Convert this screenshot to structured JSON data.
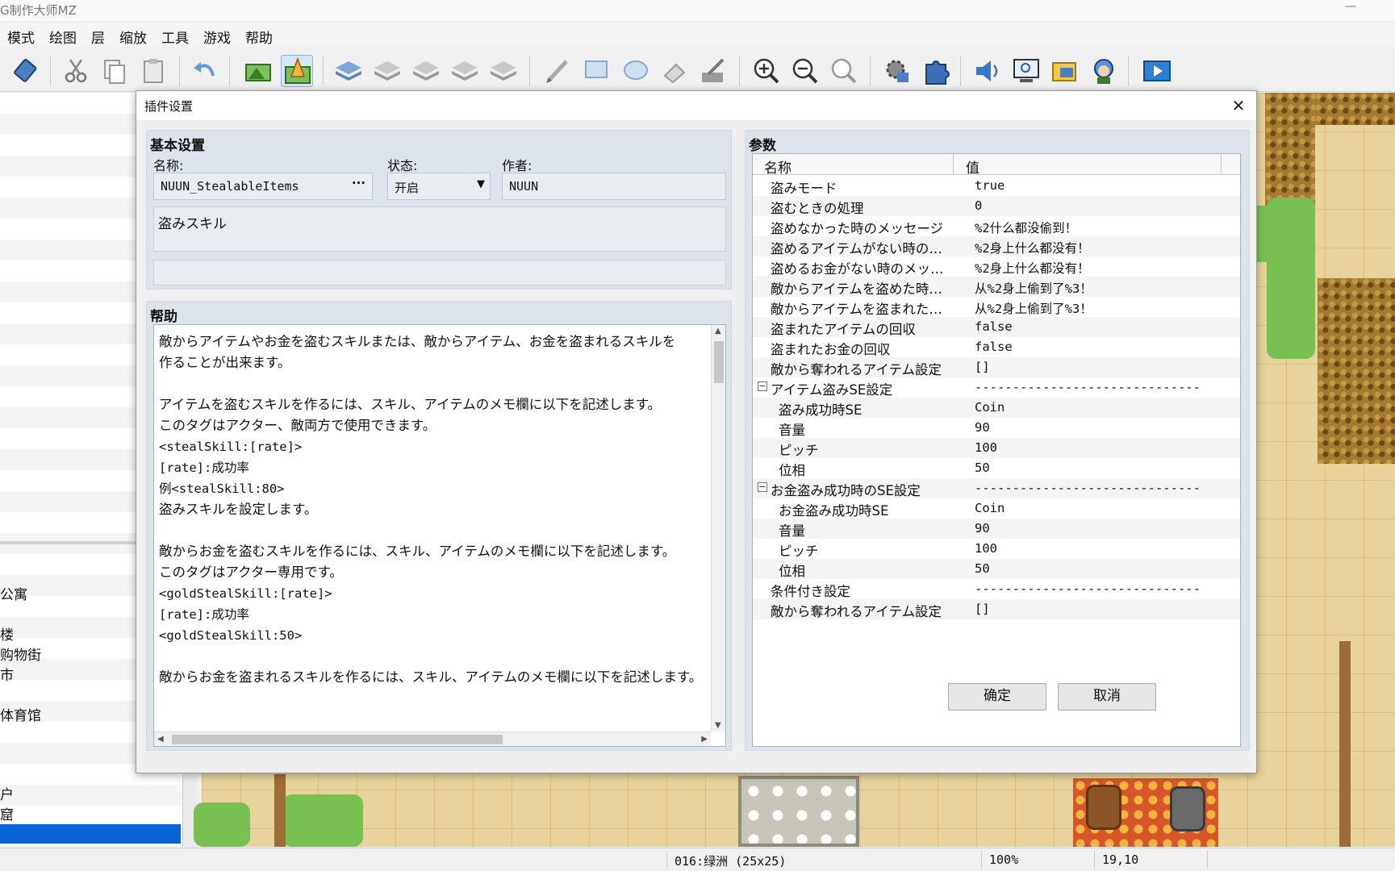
{
  "window": {
    "title": "G制作大师MZ",
    "minimize": "—"
  },
  "menu": [
    "模式",
    "绘图",
    "层",
    "缩放",
    "工具",
    "游戏",
    "帮助"
  ],
  "toolbar_icons": [
    "database-icon",
    "cut-icon",
    "copy-icon",
    "paste-icon",
    "undo-icon",
    "map-mode-icon",
    "event-mode-icon",
    "layer-a-icon",
    "layer-b-icon",
    "layer-c-icon",
    "layer-d-icon",
    "layer-e-icon",
    "pencil-icon",
    "rectangle-icon",
    "ellipse-icon",
    "fill-icon",
    "shadow-pen-icon",
    "zoom-in-icon",
    "zoom-out-icon",
    "zoom-actual-icon",
    "database-settings-icon",
    "plugin-manager-icon",
    "sound-test-icon",
    "event-searcher-icon",
    "resource-manager-icon",
    "character-generator-icon",
    "playtest-icon"
  ],
  "left_items": [
    "公寓",
    "楼",
    "购物街",
    "市",
    "体育馆",
    "户",
    "窟"
  ],
  "status": {
    "map": "016:绿洲 (25x25)",
    "zoom": "100%",
    "coords": "19,10"
  },
  "dialog": {
    "title": "插件设置",
    "basic": {
      "title": "基本设置",
      "name_label": "名称:",
      "name_value": "NUUN_StealableItems",
      "name_more": "···",
      "status_label": "状态:",
      "status_value": "开启",
      "author_label": "作者:",
      "author_value": "NUUN",
      "description": "盗みスキル",
      "extra": ""
    },
    "help": {
      "title": "帮助",
      "lines": [
        "敵からアイテムやお金を盗むスキルまたは、敵からアイテム、お金を盗まれるスキルを",
        "作ることが出来ます。",
        "",
        "アイテムを盗むスキルを作るには、スキル、アイテムのメモ欄に以下を記述します。",
        "このタグはアクター、敵両方で使用できます。",
        "<stealSkill:[rate]>",
        "[rate]:成功率",
        "例<stealSkill:80>",
        "盗みスキルを設定します。",
        "",
        "敵からお金を盗むスキルを作るには、スキル、アイテムのメモ欄に以下を記述します。",
        "このタグはアクター専用です。",
        "<goldStealSkill:[rate]>",
        "[rate]:成功率",
        "<goldStealSkill:50>",
        "",
        "敵からお金を盗まれるスキルを作るには、スキル、アイテムのメモ欄に以下を記述します。"
      ]
    },
    "params": {
      "title": "参数",
      "col_name": "名称",
      "col_value": "值",
      "rows": [
        {
          "name": "盗みモード",
          "value": "true",
          "indent": 0
        },
        {
          "name": "盗むときの処理",
          "value": "0",
          "indent": 0
        },
        {
          "name": "盗めなかった時のメッセージ",
          "value": "%2什么都没偷到！",
          "indent": 0
        },
        {
          "name": "盗めるアイテムがない時の…",
          "value": "%2身上什么都没有！",
          "indent": 0
        },
        {
          "name": "盗めるお金がない時のメッ…",
          "value": "%2身上什么都没有！",
          "indent": 0
        },
        {
          "name": "敵からアイテムを盗めた時…",
          "value": "从%2身上偷到了%3！",
          "indent": 0
        },
        {
          "name": "敵からアイテムを盗まれた…",
          "value": "从%2身上偷到了%3！",
          "indent": 0
        },
        {
          "name": "盗まれたアイテムの回収",
          "value": "false",
          "indent": 0
        },
        {
          "name": "盗まれたお金の回収",
          "value": "false",
          "indent": 0
        },
        {
          "name": "敵から奪われるアイテム設定",
          "value": "[]",
          "indent": 0
        },
        {
          "name": "アイテム盗みSE設定",
          "value": "------------------------------",
          "indent": 0,
          "toggle": "⊟"
        },
        {
          "name": "盗み成功時SE",
          "value": "Coin",
          "indent": 1
        },
        {
          "name": "音量",
          "value": "90",
          "indent": 1
        },
        {
          "name": "ピッチ",
          "value": "100",
          "indent": 1
        },
        {
          "name": "位相",
          "value": "50",
          "indent": 1
        },
        {
          "name": "お金盗み成功時のSE設定",
          "value": "------------------------------",
          "indent": 0,
          "toggle": "⊟"
        },
        {
          "name": "お金盗み成功時SE",
          "value": "Coin",
          "indent": 1
        },
        {
          "name": "音量",
          "value": "90",
          "indent": 1
        },
        {
          "name": "ピッチ",
          "value": "100",
          "indent": 1
        },
        {
          "name": "位相",
          "value": "50",
          "indent": 1
        },
        {
          "name": "条件付き設定",
          "value": "------------------------------",
          "indent": 0
        },
        {
          "name": "敵から奪われるアイテム設定",
          "value": "[]",
          "indent": 0
        }
      ]
    },
    "ok_label": "确定",
    "cancel_label": "取消",
    "close": "✕"
  }
}
